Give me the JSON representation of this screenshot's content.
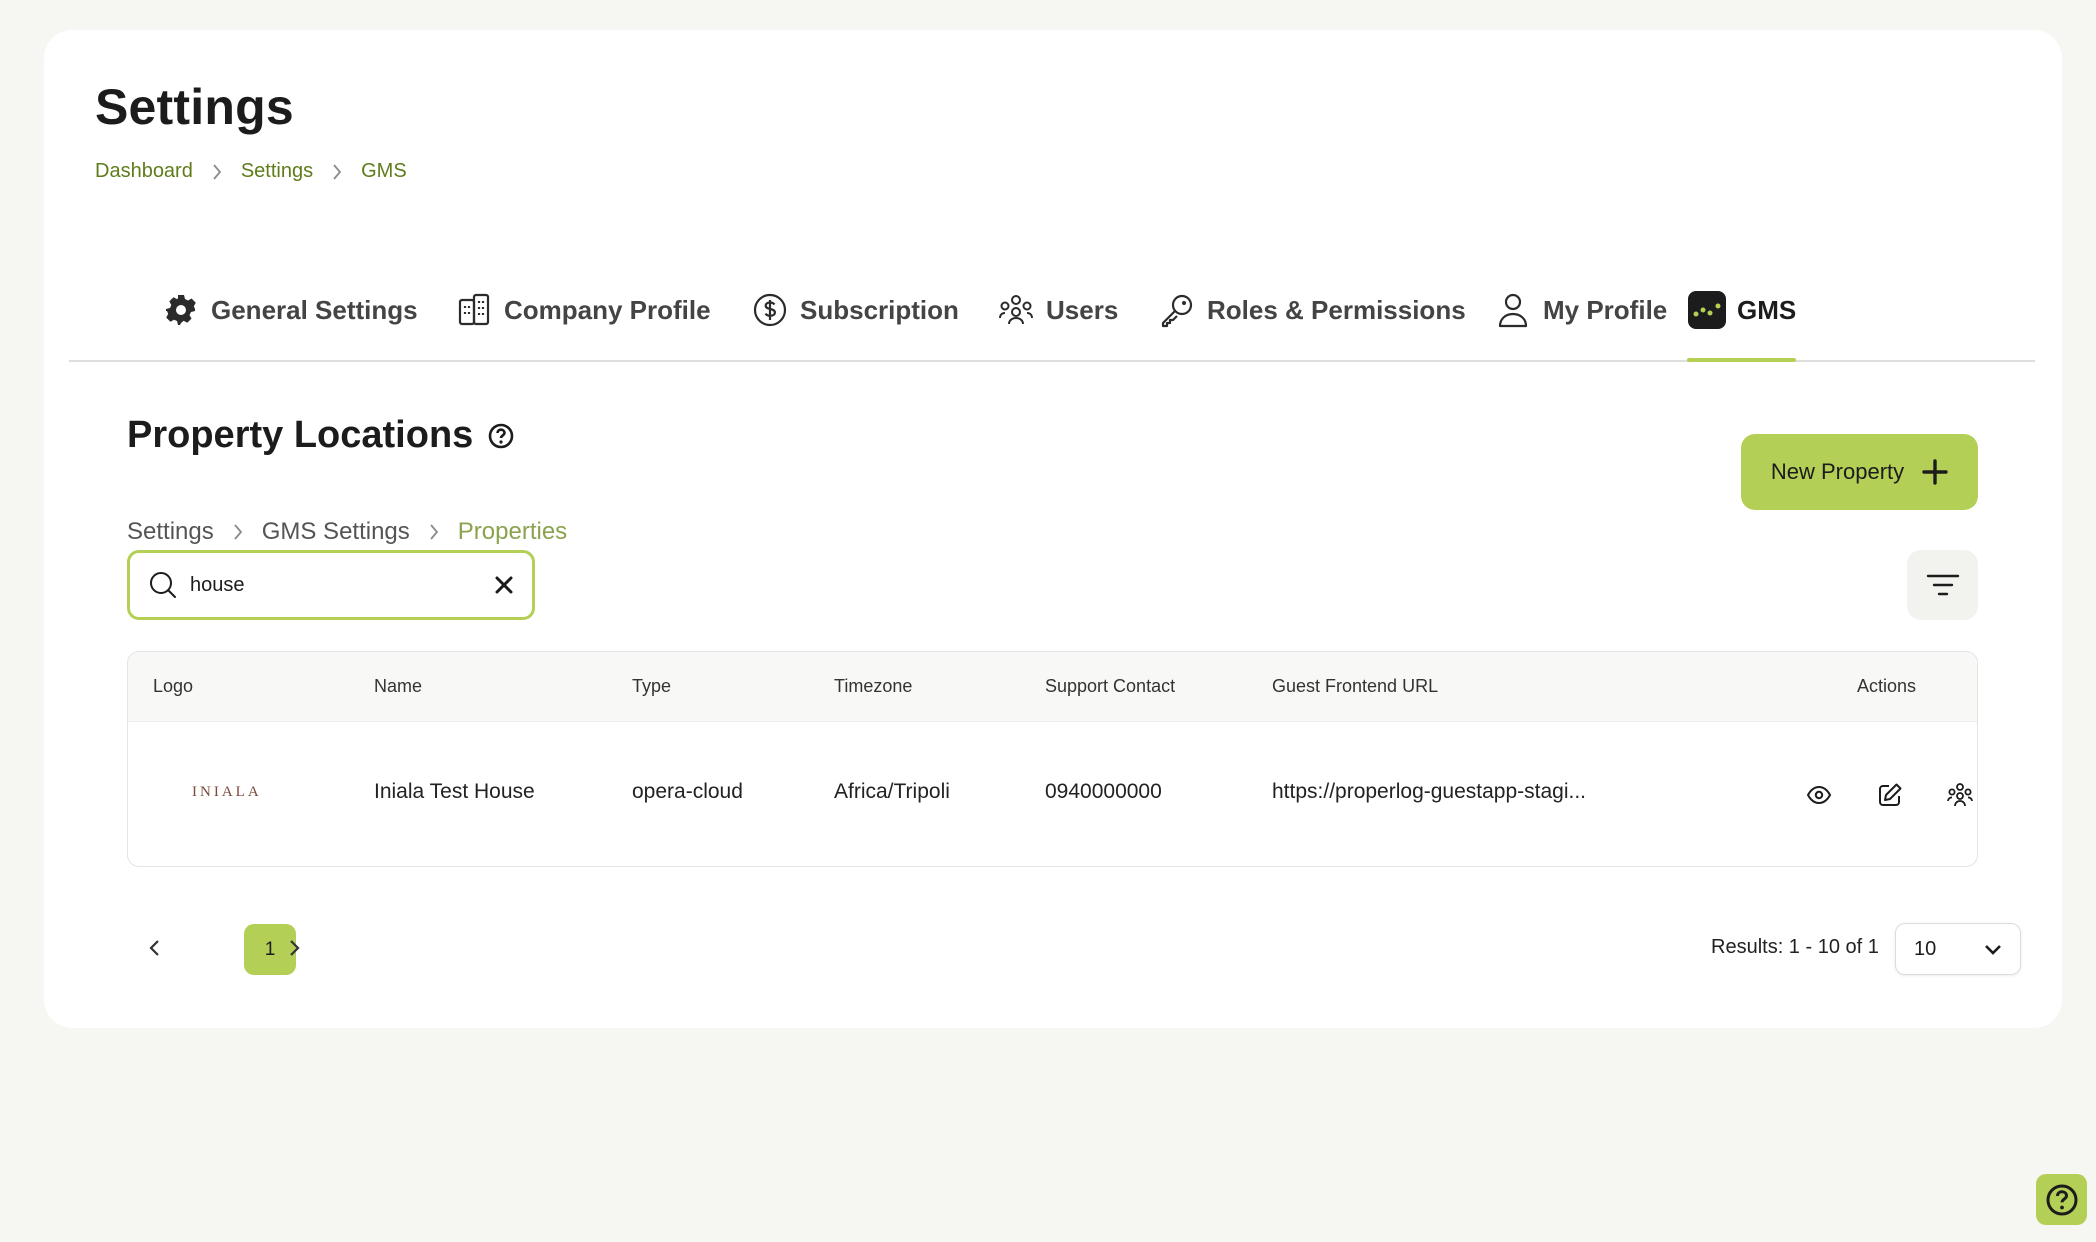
{
  "page": {
    "title": "Settings",
    "breadcrumb": [
      "Dashboard",
      "Settings",
      "GMS"
    ]
  },
  "tabs": [
    {
      "label": "General Settings",
      "icon": "gear-icon"
    },
    {
      "label": "Company Profile",
      "icon": "building-icon"
    },
    {
      "label": "Subscription",
      "icon": "dollar-circle-icon"
    },
    {
      "label": "Users",
      "icon": "users-icon"
    },
    {
      "label": "Roles & Permissions",
      "icon": "key-icon"
    },
    {
      "label": "My Profile",
      "icon": "user-icon"
    },
    {
      "label": "GMS",
      "icon": "gms-logo-icon",
      "active": true
    }
  ],
  "section": {
    "title": "Property Locations",
    "breadcrumb": [
      "Settings",
      "GMS Settings",
      "Properties"
    ],
    "new_button": "New Property"
  },
  "search": {
    "value": "house",
    "placeholder": ""
  },
  "table": {
    "columns": [
      "Logo",
      "Name",
      "Type",
      "Timezone",
      "Support Contact",
      "Guest Frontend URL",
      "Actions"
    ],
    "rows": [
      {
        "logo_text": "INIALA",
        "name": "Iniala Test House",
        "type": "opera-cloud",
        "timezone": "Africa/Tripoli",
        "support_contact": "0940000000",
        "guest_url": "https://properlog-guestapp-stagi..."
      }
    ]
  },
  "pagination": {
    "current_page": "1",
    "results": "Results: 1 - 10 of 1",
    "per_page": "10"
  },
  "colors": {
    "accent": "#b4cf56",
    "breadcrumb_link": "#5e7d1a",
    "current_crumb": "#8ba24f"
  }
}
